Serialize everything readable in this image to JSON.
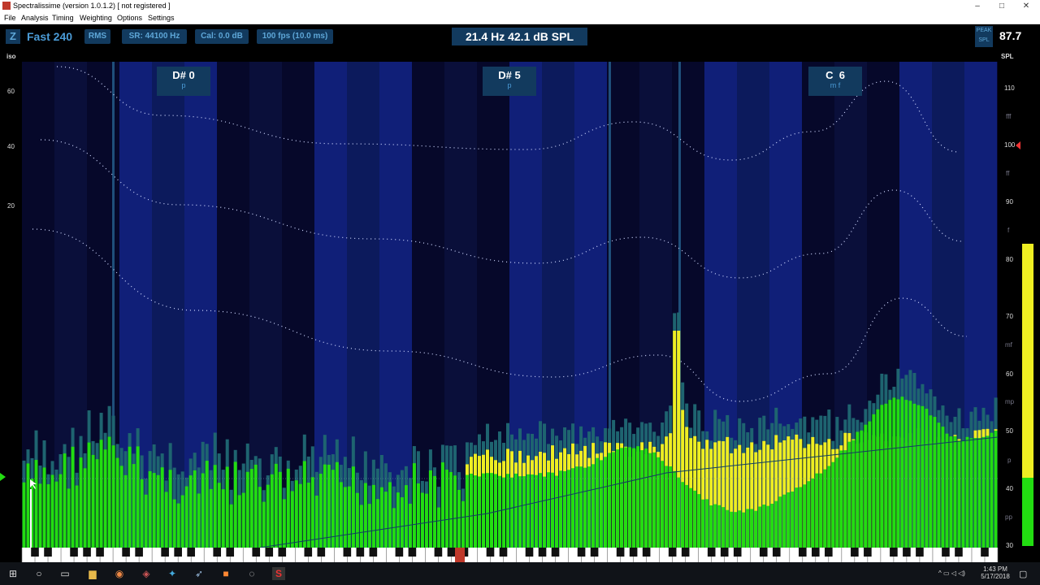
{
  "window": {
    "title": "Spectralissime (version 1.0.1.2) [ not registered ]"
  },
  "menu": [
    "File",
    "Analysis",
    "Timing",
    "Weighting",
    "Options",
    "Settings"
  ],
  "toolbar": {
    "zoom_label": "Z",
    "mode": "Fast 240",
    "rms": "RMS",
    "sample_rate": "SR: 44100 Hz",
    "calibration": "Cal:  0.0 dB",
    "fps": "100 fps (10.0 ms)",
    "readout": "21.4 Hz   42.1 dB SPL",
    "peak_label": "PEAK",
    "spl_label": "SPL",
    "peak_value": "87.7"
  },
  "left_axis": {
    "title": "iso",
    "ticks": [
      "60",
      "40",
      "20"
    ]
  },
  "right_axis": {
    "title": "SPL",
    "ticks": [
      "110",
      "100",
      "90",
      "80",
      "70",
      "60",
      "50",
      "40",
      "30"
    ],
    "dynamics": [
      "fff",
      "ff",
      "f",
      "mf",
      "mp",
      "p",
      "pp"
    ]
  },
  "notes": [
    {
      "note": "D# 0",
      "dyn": "p"
    },
    {
      "note": "D# 5",
      "dyn": "p"
    },
    {
      "note": "C  6",
      "dyn": "m f"
    }
  ],
  "taskbar": {
    "time": "1:43 PM",
    "date": "5/17/2018"
  },
  "colors": {
    "accent": "#4b9bd6",
    "pill_bg": "#123a5e",
    "green": "#22dd11",
    "yellow": "#eeee22",
    "teal": "#1e6470"
  }
}
